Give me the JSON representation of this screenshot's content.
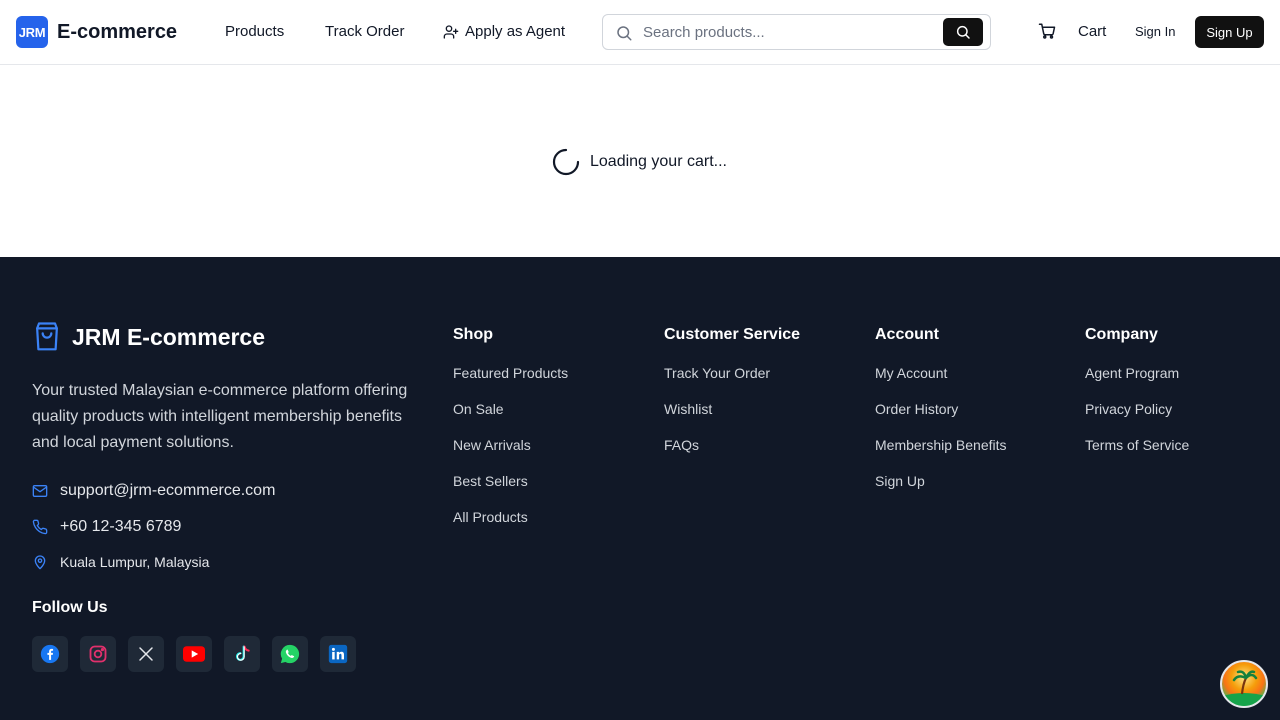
{
  "header": {
    "logo_text": "JRM",
    "brand": "E-commerce",
    "nav": {
      "products": "Products",
      "track_order": "Track Order",
      "apply_agent": "Apply as Agent"
    },
    "search": {
      "placeholder": "Search products..."
    },
    "cart_label": "Cart",
    "sign_in": "Sign In",
    "sign_up": "Sign Up"
  },
  "main": {
    "loading_text": "Loading your cart..."
  },
  "footer": {
    "brand": "JRM E-commerce",
    "description": "Your trusted Malaysian e-commerce platform offering quality products with intelligent membership benefits and local payment solutions.",
    "email": "support@jrm-ecommerce.com",
    "phone": "+60 12-345 6789",
    "location": "Kuala Lumpur, Malaysia",
    "follow_us": "Follow Us",
    "socials": [
      "facebook",
      "instagram",
      "x",
      "youtube",
      "tiktok",
      "whatsapp",
      "linkedin"
    ],
    "columns": {
      "shop": {
        "title": "Shop",
        "links": [
          "Featured Products",
          "On Sale",
          "New Arrivals",
          "Best Sellers",
          "All Products"
        ]
      },
      "customer_service": {
        "title": "Customer Service",
        "links": [
          "Track Your Order",
          "Wishlist",
          "FAQs"
        ]
      },
      "account": {
        "title": "Account",
        "links": [
          "My Account",
          "Order History",
          "Membership Benefits",
          "Sign Up"
        ]
      },
      "company": {
        "title": "Company",
        "links": [
          "Agent Program",
          "Privacy Policy",
          "Terms of Service"
        ]
      }
    }
  },
  "colors": {
    "brand_blue": "#2563eb",
    "footer_bg": "#111827",
    "button_dark": "#111111"
  }
}
